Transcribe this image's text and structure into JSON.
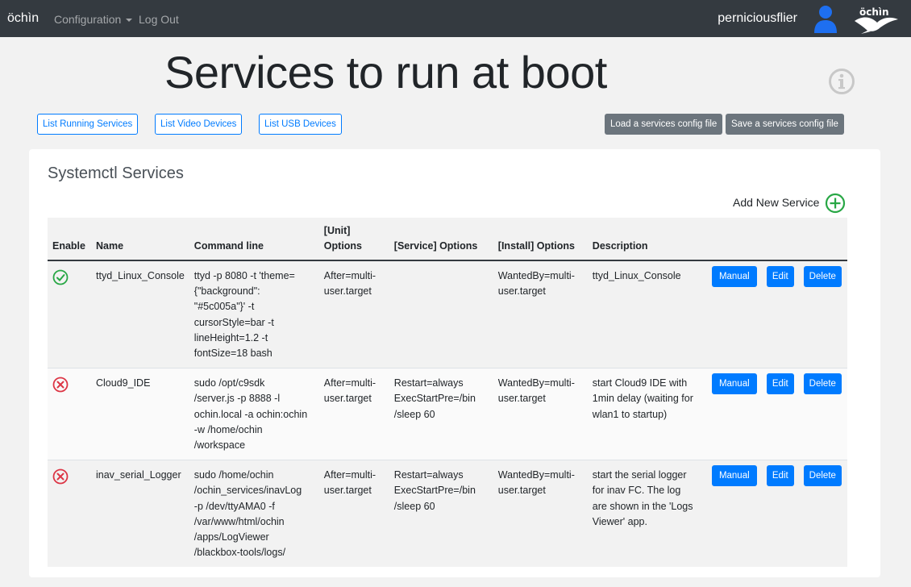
{
  "navbar": {
    "brand": "öchìn",
    "config_label": "Configuration",
    "logout_label": "Log Out",
    "username": "perniciousflier",
    "user_icon": "user-icon",
    "logo_icon": "ochin-bird-logo"
  },
  "header": {
    "title": "Services to run at boot",
    "info_icon": "info-circle-icon"
  },
  "toolbar": {
    "list_running": "List Running Services",
    "list_video": "List Video Devices",
    "list_usb": "List USB Devices",
    "load_config": "Load a services config file",
    "save_config": "Save a services config file"
  },
  "card": {
    "title": "Systemctl Services",
    "add_label": "Add New Service",
    "add_icon": "plus-circle-icon"
  },
  "table": {
    "columns": [
      "Enable",
      "Name",
      "Command line",
      "[Unit] Options",
      "[Service] Options",
      "[Install] Options",
      "Description"
    ],
    "column_unit_line1": "[Unit]",
    "column_unit_line2": "Options",
    "rows": [
      {
        "enabled": true,
        "name": "ttyd_Linux_Console",
        "command": [
          "ttyd -p 8080 -t 'theme=",
          "{\"background\":",
          "\"#5c005a\"}' -t",
          "cursorStyle=bar -t",
          "lineHeight=1.2 -t",
          "fontSize=18 bash"
        ],
        "unit": [
          "After=multi-",
          "user.target"
        ],
        "service": [],
        "install": [
          "WantedBy=multi-",
          "user.target"
        ],
        "description": [
          "ttyd_Linux_Console"
        ]
      },
      {
        "enabled": false,
        "name": "Cloud9_IDE",
        "command": [
          "sudo /opt/c9sdk",
          "/server.js -p 8888 -l",
          "ochin.local -a ochin:ochin",
          "-w /home/ochin",
          "/workspace"
        ],
        "unit": [
          "After=multi-",
          "user.target"
        ],
        "service": [
          "Restart=always",
          "ExecStartPre=/bin",
          "/sleep 60"
        ],
        "install": [
          "WantedBy=multi-",
          "user.target"
        ],
        "description": [
          "start Cloud9 IDE with",
          "1min delay (waiting for",
          "wlan1 to startup)"
        ]
      },
      {
        "enabled": false,
        "name": "inav_serial_Logger",
        "command": [
          "sudo /home/ochin",
          "/ochin_services/inavLog",
          "-p /dev/ttyAMA0 -f",
          "/var/www/html/ochin",
          "/apps/LogViewer",
          "/blackbox-tools/logs/"
        ],
        "unit": [
          "After=multi-",
          "user.target"
        ],
        "service": [
          "Restart=always",
          "ExecStartPre=/bin",
          "/sleep 60"
        ],
        "install": [
          "WantedBy=multi-",
          "user.target"
        ],
        "description": [
          "start the serial logger",
          "for inav FC. The log",
          "are shown in the 'Logs",
          "Viewer' app."
        ]
      }
    ],
    "actions": {
      "manual": "Manual",
      "edit": "Edit",
      "delete": "Delete"
    }
  },
  "colors": {
    "navbar": "#343a40",
    "primary": "#007bff",
    "secondary": "#6c757d",
    "enabled": "#28a745",
    "disabled": "#dc3545"
  }
}
